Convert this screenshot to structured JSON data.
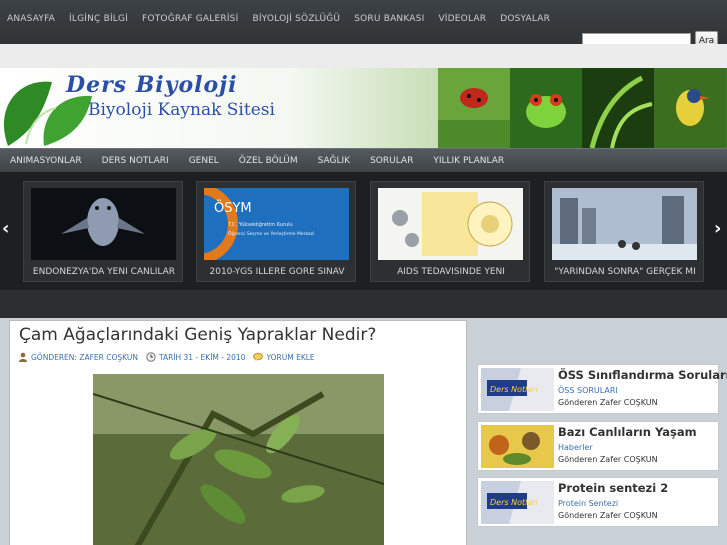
{
  "topnav": {
    "items": [
      "ANASAYFA",
      "İLGİNÇ BİLGİ",
      "FOTOĞRAF GALERİSİ",
      "BİYOLOJİ SÖZLÜĞÜ",
      "SORU BANKASI",
      "VİDEOLAR",
      "DOSYALAR"
    ]
  },
  "search": {
    "value": "",
    "button_label": "Ara"
  },
  "banner": {
    "title": "Ders Biyoloji",
    "subtitle": "Biyoloji Kaynak Sitesi"
  },
  "catnav": {
    "items": [
      "ANIMASYONLAR",
      "DERS NOTLARI",
      "GENEL",
      "ÖZEL BÖLÜM",
      "SAĞLIK",
      "SORULAR",
      "YILLIK PLANLAR"
    ]
  },
  "slider": {
    "prev_glyph": "‹",
    "next_glyph": "›",
    "slides": [
      {
        "caption": "ENDONEZYA'DA YENİ CANLILAR"
      },
      {
        "caption": "2010-YGS İLLERE GÖRE SINAV",
        "image_text": "ÖSYM",
        "image_sub": "T.C. Yükseköğretim Kurulu",
        "image_sub2": "Öğrenci Seçme ve Yerleştirme Merkezi"
      },
      {
        "caption": "AIDS TEDAVİSİNDE YENİ"
      },
      {
        "caption": "\"YARINDAN SONRA\" GERÇEK Mİ"
      }
    ]
  },
  "article": {
    "title": "Çam Ağaçlarındaki Geniş Yapraklar Nedir?",
    "author": "GÖNDEREN: ZAFER COŞKUN",
    "date": "TARİH 31 - EKİM - 2010",
    "comment": "YORUM EKLE"
  },
  "sidebar": {
    "items": [
      {
        "title": "ÖSS Sınıflandırma Soruları",
        "category": "ÖSS SORULARI",
        "author": "Gönderen Zafer COŞKUN",
        "thumb_text": "Ders Notları"
      },
      {
        "title": "Bazı Canlıların Yaşam",
        "category": "Haberler",
        "author": "Gönderen Zafer COŞKUN"
      },
      {
        "title": "Protein sentezi 2",
        "category": "Protein Sentezi",
        "author": "Gönderen Zafer COŞKUN",
        "thumb_text": "Ders Notları"
      }
    ]
  }
}
